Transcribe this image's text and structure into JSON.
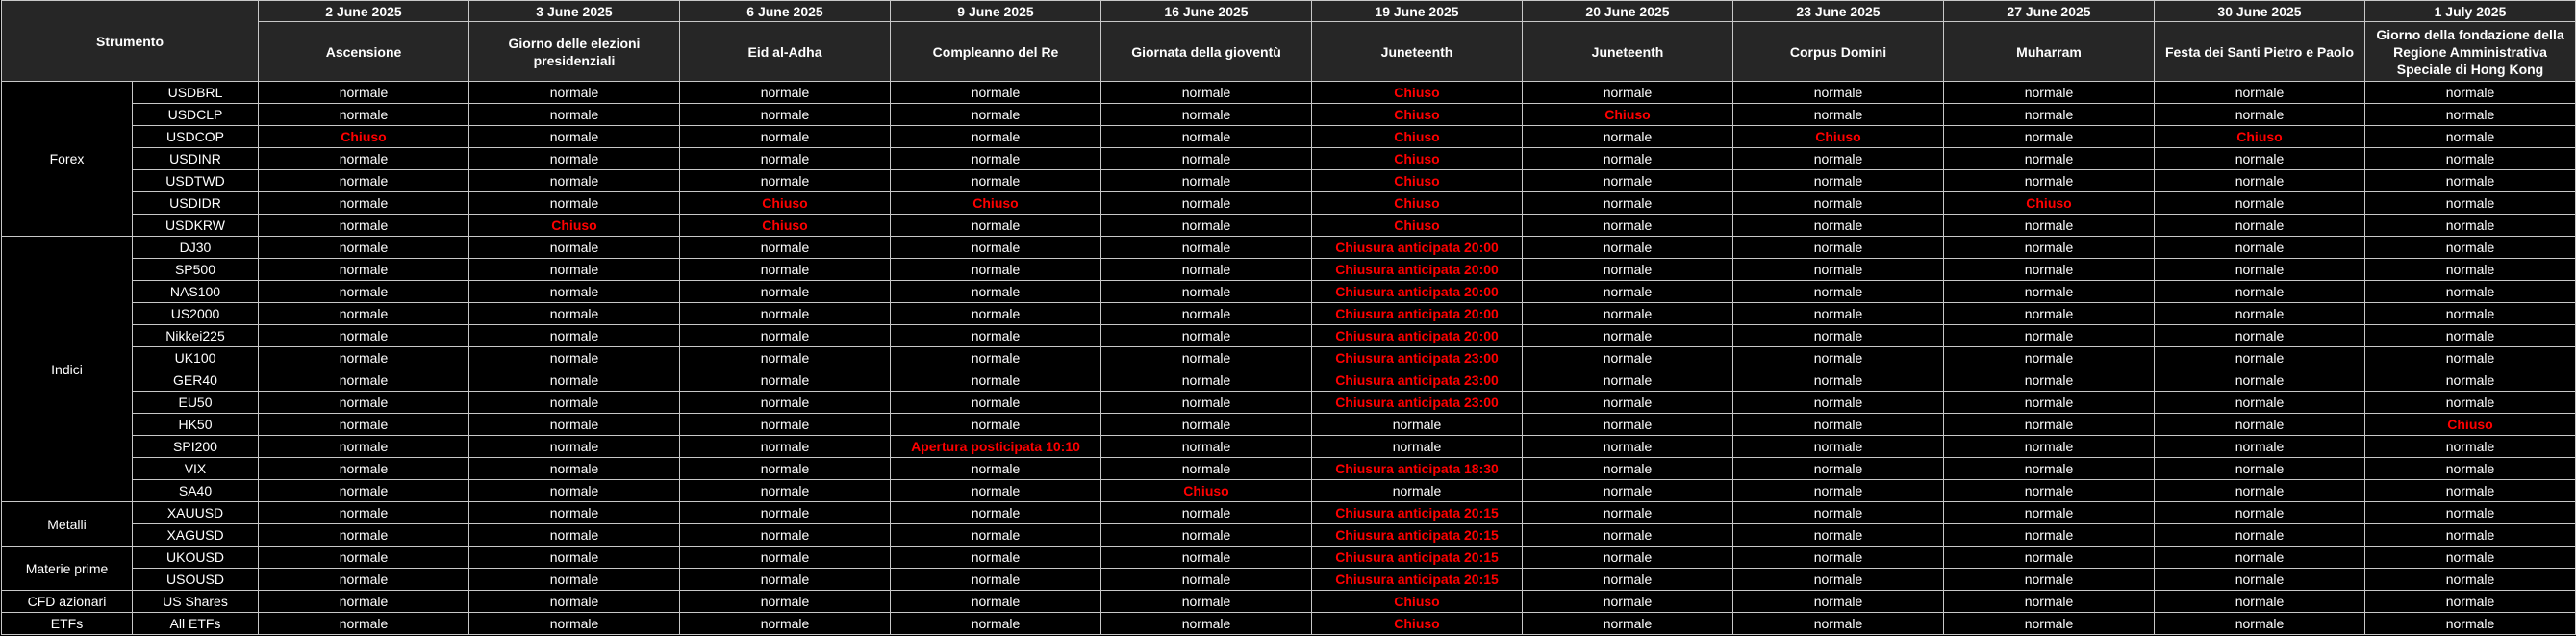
{
  "header": {
    "instrument_label": "Strumento",
    "dates": [
      "2 June 2025",
      "3 June 2025",
      "6 June 2025",
      "9 June 2025",
      "16 June 2025",
      "19 June 2025",
      "20 June 2025",
      "23 June 2025",
      "27 June 2025",
      "30 June 2025",
      "1 July 2025"
    ],
    "holidays": [
      "Ascensione",
      "Giorno delle elezioni presidenziali",
      "Eid al-Adha",
      "Compleanno del Re",
      "Giornata della gioventù",
      "Juneteenth",
      "Juneteenth",
      "Corpus Domini",
      "Muharram",
      "Festa dei Santi Pietro e Paolo",
      "Giorno della fondazione della Regione Amministrativa Speciale di Hong Kong"
    ]
  },
  "status": {
    "normal": "normale",
    "closed_word": "Chiuso"
  },
  "colors": {
    "closed": "#ff0000",
    "header_bg": "#262626",
    "background": "#000000",
    "border": "#c8c8c8"
  },
  "rows": [
    {
      "category": "Forex",
      "span": 7,
      "symbol": "USDBRL",
      "cells": [
        "normale",
        "normale",
        "normale",
        "normale",
        "normale",
        "Chiuso",
        "normale",
        "normale",
        "normale",
        "normale",
        "normale"
      ]
    },
    {
      "symbol": "USDCLP",
      "cells": [
        "normale",
        "normale",
        "normale",
        "normale",
        "normale",
        "Chiuso",
        "Chiuso",
        "normale",
        "normale",
        "normale",
        "normale"
      ]
    },
    {
      "symbol": "USDCOP",
      "cells": [
        "Chiuso",
        "normale",
        "normale",
        "normale",
        "normale",
        "Chiuso",
        "normale",
        "Chiuso",
        "normale",
        "Chiuso",
        "normale"
      ]
    },
    {
      "symbol": "USDINR",
      "cells": [
        "normale",
        "normale",
        "normale",
        "normale",
        "normale",
        "Chiuso",
        "normale",
        "normale",
        "normale",
        "normale",
        "normale"
      ]
    },
    {
      "symbol": "USDTWD",
      "cells": [
        "normale",
        "normale",
        "normale",
        "normale",
        "normale",
        "Chiuso",
        "normale",
        "normale",
        "normale",
        "normale",
        "normale"
      ]
    },
    {
      "symbol": "USDIDR",
      "cells": [
        "normale",
        "normale",
        "Chiuso",
        "Chiuso",
        "normale",
        "Chiuso",
        "normale",
        "normale",
        "Chiuso",
        "normale",
        "normale"
      ]
    },
    {
      "symbol": "USDKRW",
      "cells": [
        "normale",
        "Chiuso",
        "Chiuso",
        "normale",
        "normale",
        "Chiuso",
        "normale",
        "normale",
        "normale",
        "normale",
        "normale"
      ]
    },
    {
      "category": "Indici",
      "span": 12,
      "symbol": "DJ30",
      "cells": [
        "normale",
        "normale",
        "normale",
        "normale",
        "normale",
        "Chiusura anticipata 20:00",
        "normale",
        "normale",
        "normale",
        "normale",
        "normale"
      ]
    },
    {
      "symbol": "SP500",
      "cells": [
        "normale",
        "normale",
        "normale",
        "normale",
        "normale",
        "Chiusura anticipata 20:00",
        "normale",
        "normale",
        "normale",
        "normale",
        "normale"
      ]
    },
    {
      "symbol": "NAS100",
      "cells": [
        "normale",
        "normale",
        "normale",
        "normale",
        "normale",
        "Chiusura anticipata 20:00",
        "normale",
        "normale",
        "normale",
        "normale",
        "normale"
      ]
    },
    {
      "symbol": "US2000",
      "cells": [
        "normale",
        "normale",
        "normale",
        "normale",
        "normale",
        "Chiusura anticipata 20:00",
        "normale",
        "normale",
        "normale",
        "normale",
        "normale"
      ]
    },
    {
      "symbol": "Nikkei225",
      "cells": [
        "normale",
        "normale",
        "normale",
        "normale",
        "normale",
        "Chiusura anticipata 20:00",
        "normale",
        "normale",
        "normale",
        "normale",
        "normale"
      ]
    },
    {
      "symbol": "UK100",
      "cells": [
        "normale",
        "normale",
        "normale",
        "normale",
        "normale",
        "Chiusura anticipata 23:00",
        "normale",
        "normale",
        "normale",
        "normale",
        "normale"
      ]
    },
    {
      "symbol": "GER40",
      "cells": [
        "normale",
        "normale",
        "normale",
        "normale",
        "normale",
        "Chiusura anticipata 23:00",
        "normale",
        "normale",
        "normale",
        "normale",
        "normale"
      ]
    },
    {
      "symbol": "EU50",
      "cells": [
        "normale",
        "normale",
        "normale",
        "normale",
        "normale",
        "Chiusura anticipata 23:00",
        "normale",
        "normale",
        "normale",
        "normale",
        "normale"
      ]
    },
    {
      "symbol": "HK50",
      "cells": [
        "normale",
        "normale",
        "normale",
        "normale",
        "normale",
        "normale",
        "normale",
        "normale",
        "normale",
        "normale",
        "Chiuso"
      ]
    },
    {
      "symbol": "SPI200",
      "cells": [
        "normale",
        "normale",
        "normale",
        "Apertura posticipata 10:10",
        "normale",
        "normale",
        "normale",
        "normale",
        "normale",
        "normale",
        "normale"
      ]
    },
    {
      "symbol": "VIX",
      "cells": [
        "normale",
        "normale",
        "normale",
        "normale",
        "normale",
        "Chiusura anticipata 18:30",
        "normale",
        "normale",
        "normale",
        "normale",
        "normale"
      ]
    },
    {
      "symbol": "SA40",
      "cells": [
        "normale",
        "normale",
        "normale",
        "normale",
        "Chiuso",
        "normale",
        "normale",
        "normale",
        "normale",
        "normale",
        "normale"
      ]
    },
    {
      "category": "Metalli",
      "span": 2,
      "symbol": "XAUUSD",
      "cells": [
        "normale",
        "normale",
        "normale",
        "normale",
        "normale",
        "Chiusura anticipata 20:15",
        "normale",
        "normale",
        "normale",
        "normale",
        "normale"
      ]
    },
    {
      "symbol": "XAGUSD",
      "cells": [
        "normale",
        "normale",
        "normale",
        "normale",
        "normale",
        "Chiusura anticipata 20:15",
        "normale",
        "normale",
        "normale",
        "normale",
        "normale"
      ]
    },
    {
      "category": "Materie prime",
      "span": 2,
      "symbol": "UKOUSD",
      "cells": [
        "normale",
        "normale",
        "normale",
        "normale",
        "normale",
        "Chiusura anticipata 20:15",
        "normale",
        "normale",
        "normale",
        "normale",
        "normale"
      ]
    },
    {
      "symbol": "USOUSD",
      "cells": [
        "normale",
        "normale",
        "normale",
        "normale",
        "normale",
        "Chiusura anticipata 20:15",
        "normale",
        "normale",
        "normale",
        "normale",
        "normale"
      ]
    },
    {
      "category": "CFD azionari",
      "span": 1,
      "symbol": "US Shares",
      "cells": [
        "normale",
        "normale",
        "normale",
        "normale",
        "normale",
        "Chiuso",
        "normale",
        "normale",
        "normale",
        "normale",
        "normale"
      ]
    },
    {
      "category": "ETFs",
      "span": 1,
      "symbol": "All ETFs",
      "cells": [
        "normale",
        "normale",
        "normale",
        "normale",
        "normale",
        "Chiuso",
        "normale",
        "normale",
        "normale",
        "normale",
        "normale"
      ]
    }
  ]
}
